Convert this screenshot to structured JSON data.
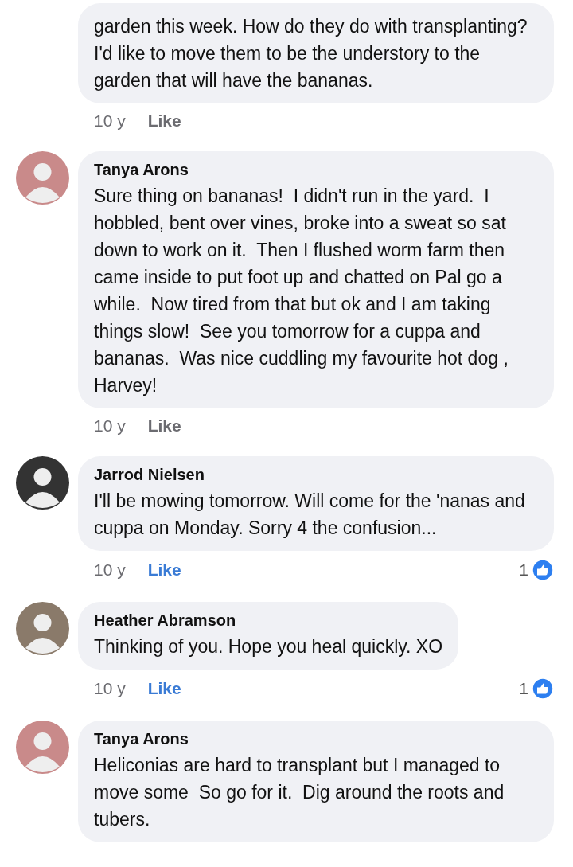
{
  "comments": [
    {
      "text": "garden this week. How do they do with transplanting?  I'd like to move them to be the understory to the garden that will have the bananas.",
      "time": "10 y",
      "like": {
        "label": "Like",
        "liked": false
      }
    },
    {
      "author": "Tanya Arons",
      "avatar": {
        "color": "#c98a8a"
      },
      "text": "Sure thing on bananas!  I didn't run in the yard.  I hobbled, bent over vines, broke into a sweat so sat down to work on it.  Then I flushed worm farm then came inside to put foot up and chatted on Pal go a while.  Now tired from that but ok and I am taking things slow!  See you tomorrow for a cuppa and bananas.  Was nice cuddling my favourite hot dog , Harvey!",
      "time": "10 y",
      "like": {
        "label": "Like",
        "liked": false
      }
    },
    {
      "author": "Jarrod Nielsen",
      "avatar": {
        "color": "#333333"
      },
      "text": "I'll be mowing tomorrow. Will come for the 'nanas and cuppa on Monday. Sorry 4 the confusion...",
      "time": "10 y",
      "like": {
        "label": "Like",
        "liked": true
      },
      "reactions": "1"
    },
    {
      "author": "Heather Abramson",
      "avatar": {
        "color": "#8a7a6a"
      },
      "text": "Thinking of you. Hope you heal quickly. XO",
      "time": "10 y",
      "like": {
        "label": "Like",
        "liked": true
      },
      "reactions": "1"
    },
    {
      "author": "Tanya Arons",
      "avatar": {
        "color": "#c98a8a"
      },
      "text": "Heliconias are hard to transplant but I managed to move some  So go for it.  Dig around the roots and tubers."
    }
  ]
}
